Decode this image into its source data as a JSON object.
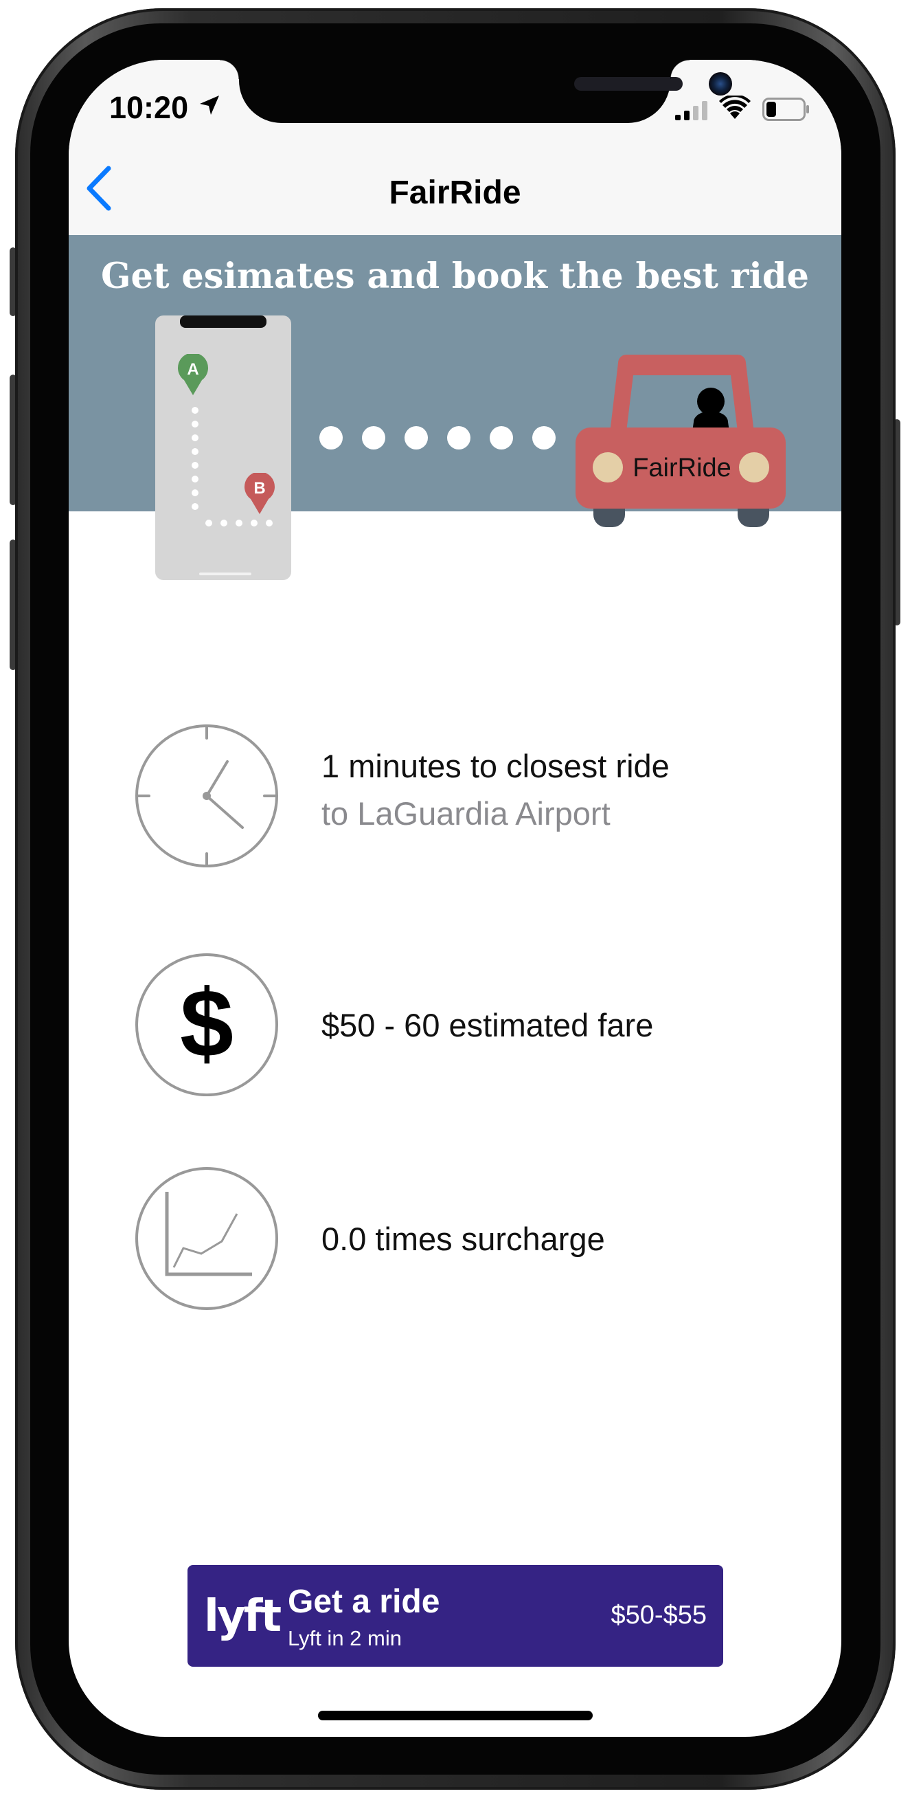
{
  "status_bar": {
    "time": "10:20"
  },
  "nav": {
    "title": "FairRide",
    "back_icon": "chevron-left-icon"
  },
  "banner": {
    "title": "Get esimates and book the best ride",
    "pin_a_label": "A",
    "pin_b_label": "B",
    "car_label": "FairRide"
  },
  "info": [
    {
      "icon": "clock-icon",
      "line1": "1 minutes to closest ride",
      "line2": "to LaGuardia Airport"
    },
    {
      "icon": "dollar-icon",
      "line1": "$50 - 60 estimated fare"
    },
    {
      "icon": "trend-chart-icon",
      "line1": "0.0 times surcharge"
    }
  ],
  "lyft_button": {
    "logo": "lyft",
    "title": "Get a ride",
    "subtitle": "Lyft in 2 min",
    "price": "$50-$55"
  },
  "colors": {
    "accent_blue": "#0a7aff",
    "banner_bg": "#7a93a2",
    "lyft_purple": "#352384",
    "pin_green": "#5a9a5a",
    "pin_red": "#c55a5a",
    "car_red": "#c86060"
  }
}
